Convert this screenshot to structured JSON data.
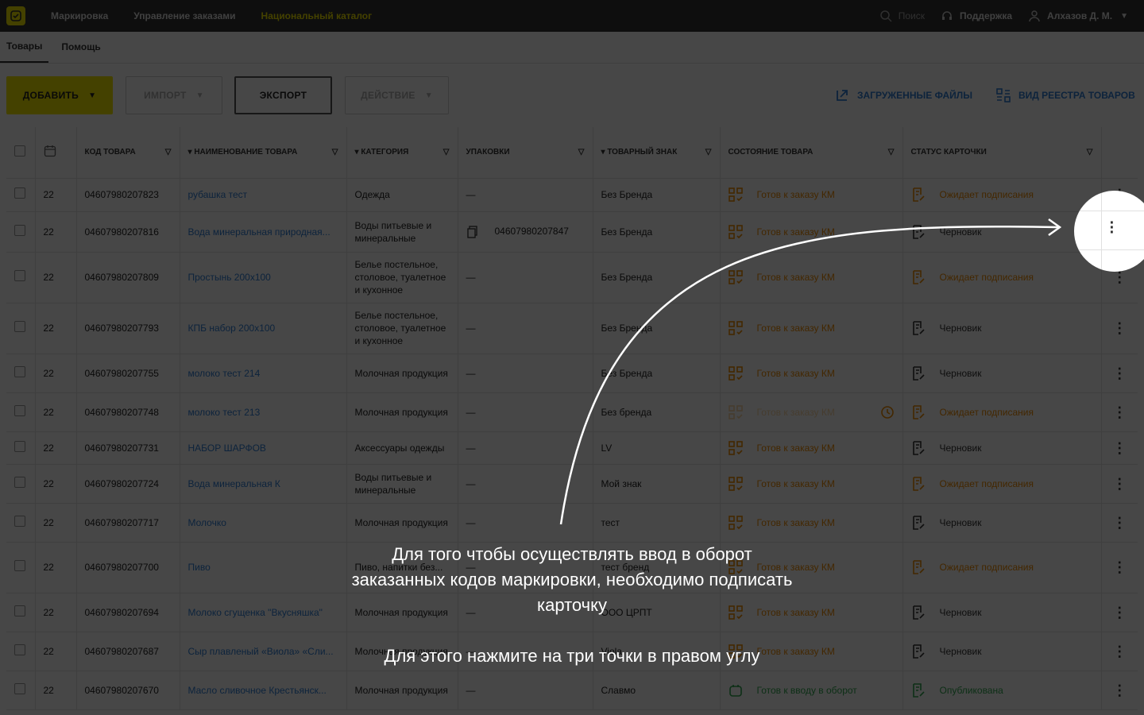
{
  "topbar": {
    "nav": [
      "Маркировка",
      "Управление заказами",
      "Национальный каталог"
    ],
    "active_index": 2,
    "search": "Поиск",
    "support": "Поддержка",
    "user": "Алхазов Д. М."
  },
  "tabs": [
    "Товары",
    "Помощь"
  ],
  "toolbar": {
    "add": "ДОБАВИТЬ",
    "import": "ИМПОРТ",
    "export": "ЭКСПОРТ",
    "action": "ДЕЙСТВИЕ",
    "uploaded_files": "ЗАГРУЖЕННЫЕ ФАЙЛЫ",
    "registry_view": "ВИД РЕЕСТРА ТОВАРОВ"
  },
  "table": {
    "headers": {
      "code": "КОД ТОВАРА",
      "name": "НАИМЕНОВАНИЕ ТОВАРА",
      "category": "КАТЕГОРИЯ",
      "packaging": "УПАКОВКИ",
      "brand": "ТОВАРНЫЙ ЗНАК",
      "state": "СОСТОЯНИЕ ТОВАРА",
      "status": "СТАТУС КАРТОЧКИ"
    },
    "rows": [
      {
        "date": "22",
        "code": "04607980207823",
        "name": "рубашка тест",
        "category": "Одежда",
        "pack": "—",
        "brand": "Без Бренда",
        "state": "Готов к заказу КМ",
        "status": "Ожидает подписания",
        "status_type": "pending"
      },
      {
        "date": "22",
        "code": "04607980207816",
        "name": "Вода минеральная природная...",
        "category": "Воды питьевые и минеральные",
        "pack": "04607980207847",
        "brand": "Без Бренда",
        "state": "Готов к заказу КМ",
        "status": "Черновик",
        "status_type": "draft"
      },
      {
        "date": "22",
        "code": "04607980207809",
        "name": "Простынь 200х100",
        "category": "Белье постельное, столовое, туалетное и кухонное",
        "pack": "—",
        "brand": "Без Бренда",
        "state": "Готов к заказу КМ",
        "status": "Ожидает подписания",
        "status_type": "pending"
      },
      {
        "date": "22",
        "code": "04607980207793",
        "name": "КПБ набор 200х100",
        "category": "Белье постельное, столовое, туалетное и кухонное",
        "pack": "—",
        "brand": "Без Бренда",
        "state": "Готов к заказу КМ",
        "status": "Черновик",
        "status_type": "draft"
      },
      {
        "date": "22",
        "code": "04607980207755",
        "name": "молоко тест 214",
        "category": "Молочная продукция",
        "pack": "—",
        "brand": "Без Бренда",
        "state": "Готов к заказу КМ",
        "status": "Черновик",
        "status_type": "draft"
      },
      {
        "date": "22",
        "code": "04607980207748",
        "name": "молоко тест 213",
        "category": "Молочная продукция",
        "pack": "—",
        "brand": "Без бренда",
        "state": "Готов к заказу КМ",
        "status": "Ожидает подписания",
        "status_type": "pending",
        "state_faded": true
      },
      {
        "date": "22",
        "code": "04607980207731",
        "name": "НАБОР ШАРФОВ",
        "category": "Аксессуары одежды",
        "pack": "—",
        "brand": "LV",
        "state": "Готов к заказу КМ",
        "status": "Черновик",
        "status_type": "draft"
      },
      {
        "date": "22",
        "code": "04607980207724",
        "name": "Вода минеральная К",
        "category": "Воды питьевые и минеральные",
        "pack": "—",
        "brand": "Мой знак",
        "state": "Готов к заказу КМ",
        "status": "Ожидает подписания",
        "status_type": "pending"
      },
      {
        "date": "22",
        "code": "04607980207717",
        "name": "Молочко",
        "category": "Молочная продукция",
        "pack": "—",
        "brand": "тест",
        "state": "Готов к заказу КМ",
        "status": "Черновик",
        "status_type": "draft"
      },
      {
        "date": "22",
        "code": "04607980207700",
        "name": "Пиво",
        "category": "Пиво, напитки без...",
        "pack": "—",
        "brand": "тест бренд",
        "state": "Готов к заказу КМ",
        "status": "Ожидает подписания",
        "status_type": "pending"
      },
      {
        "date": "22",
        "code": "04607980207694",
        "name": "Молоко сгущенка \"Вкусняшка\"",
        "category": "Молочная продукция",
        "pack": "—",
        "brand": "ООО ЦРПТ",
        "state": "Готов к заказу КМ",
        "status": "Черновик",
        "status_type": "draft"
      },
      {
        "date": "22",
        "code": "04607980207687",
        "name": "Сыр плавленый «Виола» «Сли...",
        "category": "Молочная продукция",
        "pack": "—",
        "brand": "Viola",
        "state": "Готов к заказу КМ",
        "status": "Черновик",
        "status_type": "draft"
      },
      {
        "date": "22",
        "code": "04607980207670",
        "name": "Масло сливочное Крестьянск...",
        "category": "Молочная продукция",
        "pack": "—",
        "brand": "Славмо",
        "state": "Готов к вводу в оборот",
        "status": "Опубликована",
        "status_type": "published"
      }
    ]
  },
  "hint": {
    "line1": "Для того чтобы осуществлять ввод в оборот заказанных кодов маркировки, необходимо подписать карточку",
    "line2": "Для этого нажмите на три точки в правом углу"
  },
  "colors": {
    "accent": "#f2e800",
    "link": "#2f7fd6",
    "pending": "#f08c00",
    "published": "#2fa84f"
  }
}
